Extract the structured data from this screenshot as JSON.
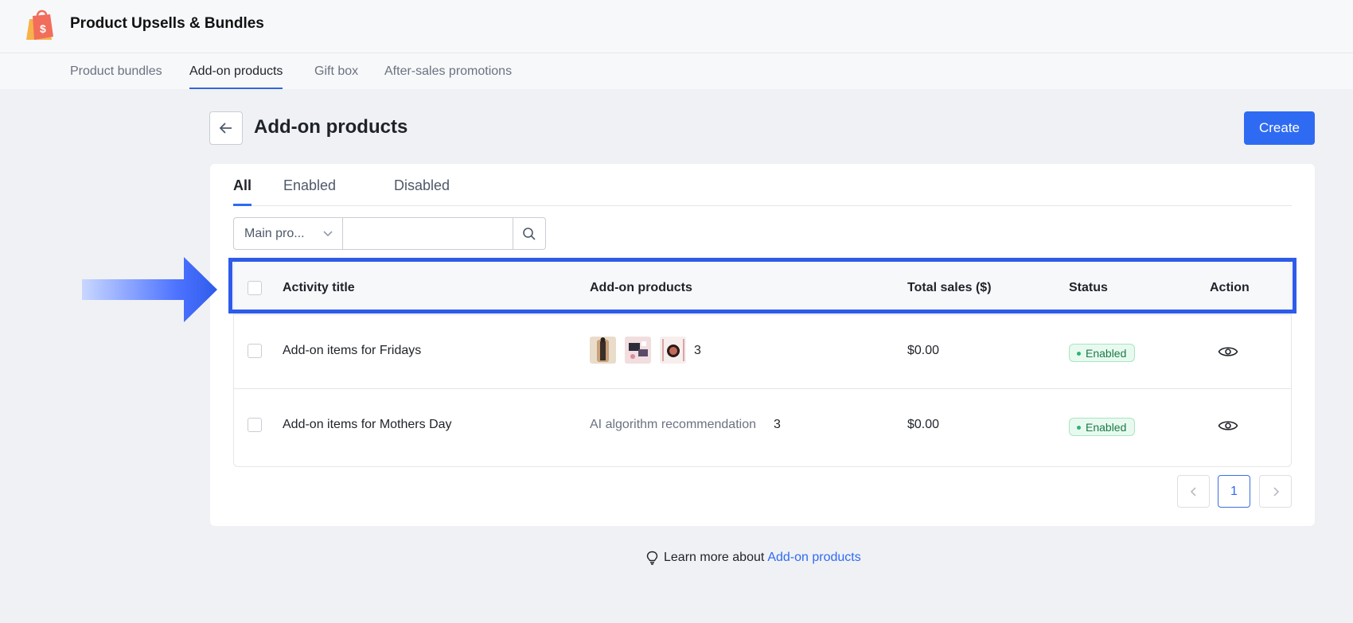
{
  "app": {
    "title": "Product Upsells & Bundles",
    "logo_icon": "shopping-bag-dollar-icon",
    "logo_color": "#f26d5b"
  },
  "nav": {
    "tabs": [
      {
        "label": "Product bundles",
        "active": false
      },
      {
        "label": "Add-on products",
        "active": true
      },
      {
        "label": "Gift box",
        "active": false
      },
      {
        "label": "After-sales promotions",
        "active": false
      }
    ]
  },
  "header": {
    "title": "Add-on products",
    "back_icon": "arrow-left-icon",
    "create_label": "Create",
    "accent_color": "#2f6bf2"
  },
  "filter": {
    "tabs": [
      {
        "label": "All",
        "active": true
      },
      {
        "label": "Enabled",
        "active": false
      },
      {
        "label": "Disabled",
        "active": false
      }
    ],
    "select_value": "Main pro...",
    "search_value": "",
    "search_placeholder": ""
  },
  "table": {
    "columns": [
      "Activity title",
      "Add-on products",
      "Total sales ($)",
      "Status",
      "Action"
    ],
    "rows": [
      {
        "title": "Add-on items for Fridays",
        "products_text": "",
        "product_count": "3",
        "total_sales": "$0.00",
        "status": "Enabled"
      },
      {
        "title": "Add-on items for Mothers Day",
        "products_text": "AI algorithm recommendation",
        "product_count": "3",
        "total_sales": "$0.00",
        "status": "Enabled"
      }
    ],
    "status_color": "#2bb673"
  },
  "pagination": {
    "current": "1"
  },
  "footer": {
    "text": "Learn more about",
    "link": "Add-on products",
    "icon": "lightbulb-icon"
  }
}
